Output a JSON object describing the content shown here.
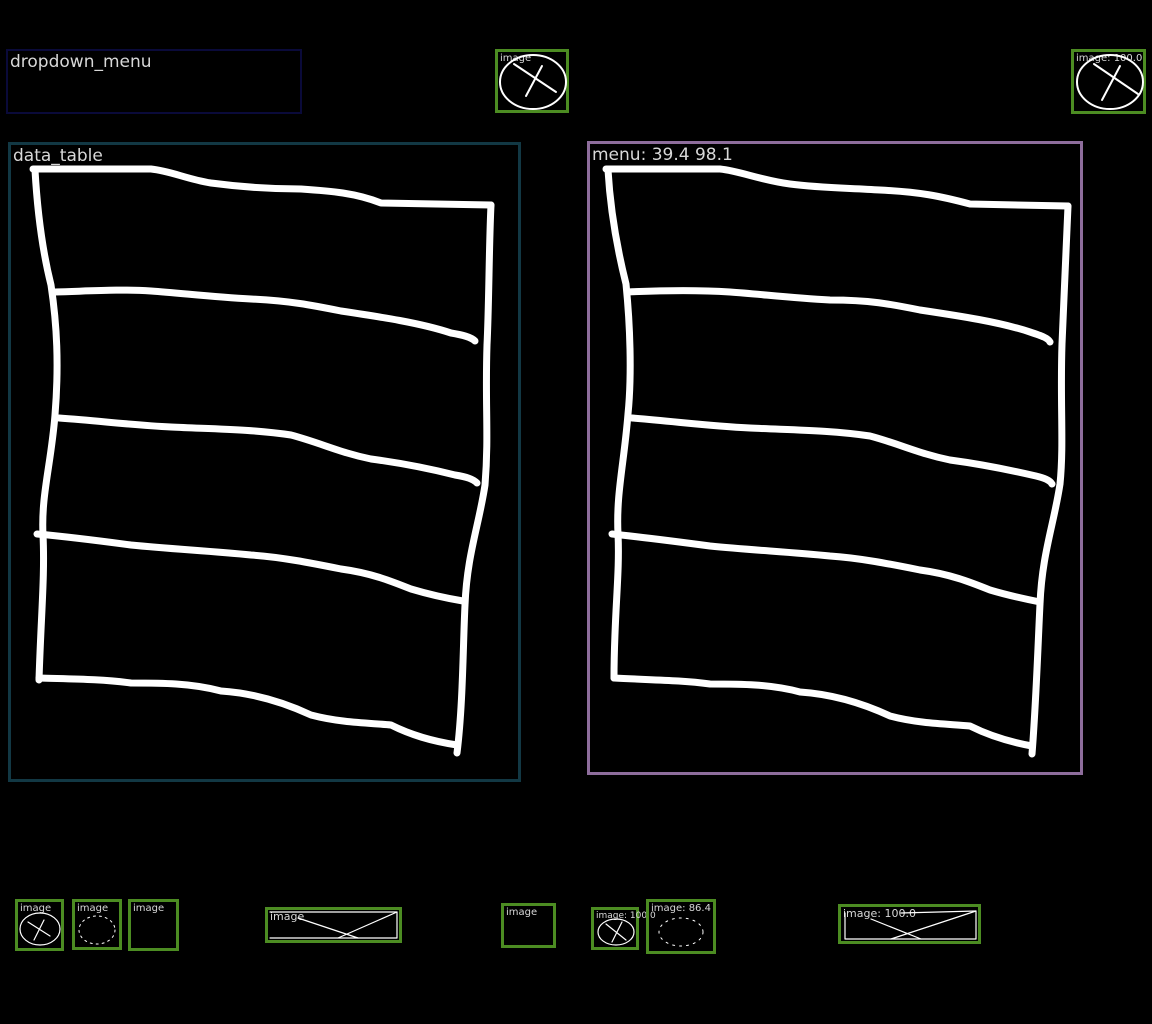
{
  "colors": {
    "background": "#000000",
    "dropdown_border": "#0a0a3a",
    "table_border": "#123844",
    "menu_border": "#8e6d9c",
    "image_border": "#4c8c22",
    "label_text": "#d8d8d8",
    "sketch_stroke": "#ffffff"
  },
  "dropdown": {
    "label": "dropdown_menu"
  },
  "data_table": {
    "label": "data_table"
  },
  "menu": {
    "label": "menu: 39.4 98.1"
  },
  "images": {
    "top_center": {
      "label": "image",
      "icon": "image-placeholder-icon"
    },
    "top_right": {
      "label": "image: 100.0",
      "icon": "image-placeholder-icon"
    },
    "bottom": [
      {
        "label": "image",
        "icon": "image-placeholder-icon"
      },
      {
        "label": "image",
        "icon": "image-placeholder-icon"
      },
      {
        "label": "image",
        "icon": "image-placeholder-icon"
      },
      {
        "label": "image",
        "icon": "image-placeholder-icon"
      },
      {
        "label": "image",
        "icon": "image-placeholder-icon"
      },
      {
        "label": "image: 100.0",
        "icon": "image-placeholder-icon"
      },
      {
        "label": "image: 86.4",
        "icon": "image-placeholder-icon"
      },
      {
        "label": "image: 100.0",
        "icon": "image-placeholder-icon"
      }
    ]
  }
}
